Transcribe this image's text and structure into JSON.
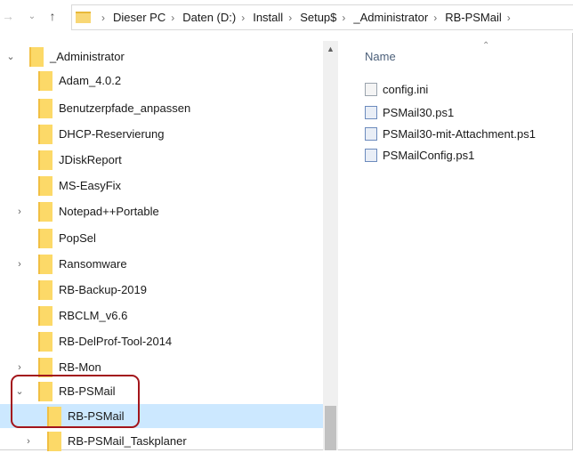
{
  "address_bar": {
    "back_icon": "arrow-left-icon",
    "recent_icon": "chevron-down-icon",
    "up_icon": "arrow-up-icon",
    "crumbs": [
      "Dieser PC",
      "Daten (D:)",
      "Install",
      "Setup$",
      "_Administrator",
      "RB-PSMail"
    ]
  },
  "tree": {
    "items": [
      {
        "label": "_Administrator",
        "expander": "expanded"
      },
      {
        "label": "Adam_4.0.2",
        "expander": "none"
      },
      {
        "label": "Benutzerpfade_anpassen",
        "expander": "none"
      },
      {
        "label": "DHCP-Reservierung",
        "expander": "none"
      },
      {
        "label": "JDiskReport",
        "expander": "none"
      },
      {
        "label": "MS-EasyFix",
        "expander": "none"
      },
      {
        "label": "Notepad++Portable",
        "expander": "collapsed"
      },
      {
        "label": "PopSel",
        "expander": "none"
      },
      {
        "label": "Ransomware",
        "expander": "collapsed"
      },
      {
        "label": "RB-Backup-2019",
        "expander": "none"
      },
      {
        "label": "RBCLM_v6.6",
        "expander": "none"
      },
      {
        "label": "RB-DelProf-Tool-2014",
        "expander": "none"
      },
      {
        "label": "RB-Mon",
        "expander": "collapsed"
      },
      {
        "label": "RB-PSMail",
        "expander": "expanded"
      },
      {
        "label": "RB-PSMail",
        "expander": "none",
        "selected": true
      },
      {
        "label": "RB-PSMail_Taskplaner",
        "expander": "collapsed"
      }
    ]
  },
  "files": {
    "column_header": "Name",
    "items": [
      {
        "label": "config.ini",
        "icon": "ini-file-icon"
      },
      {
        "label": "PSMail30.ps1",
        "icon": "powershell-file-icon"
      },
      {
        "label": "PSMail30-mit-Attachment.ps1",
        "icon": "powershell-file-icon"
      },
      {
        "label": "PSMailConfig.ps1",
        "icon": "powershell-file-icon"
      }
    ]
  },
  "colors": {
    "selection": "#cce8ff",
    "highlight_border": "#a3151b",
    "folder": "#fcd968"
  }
}
